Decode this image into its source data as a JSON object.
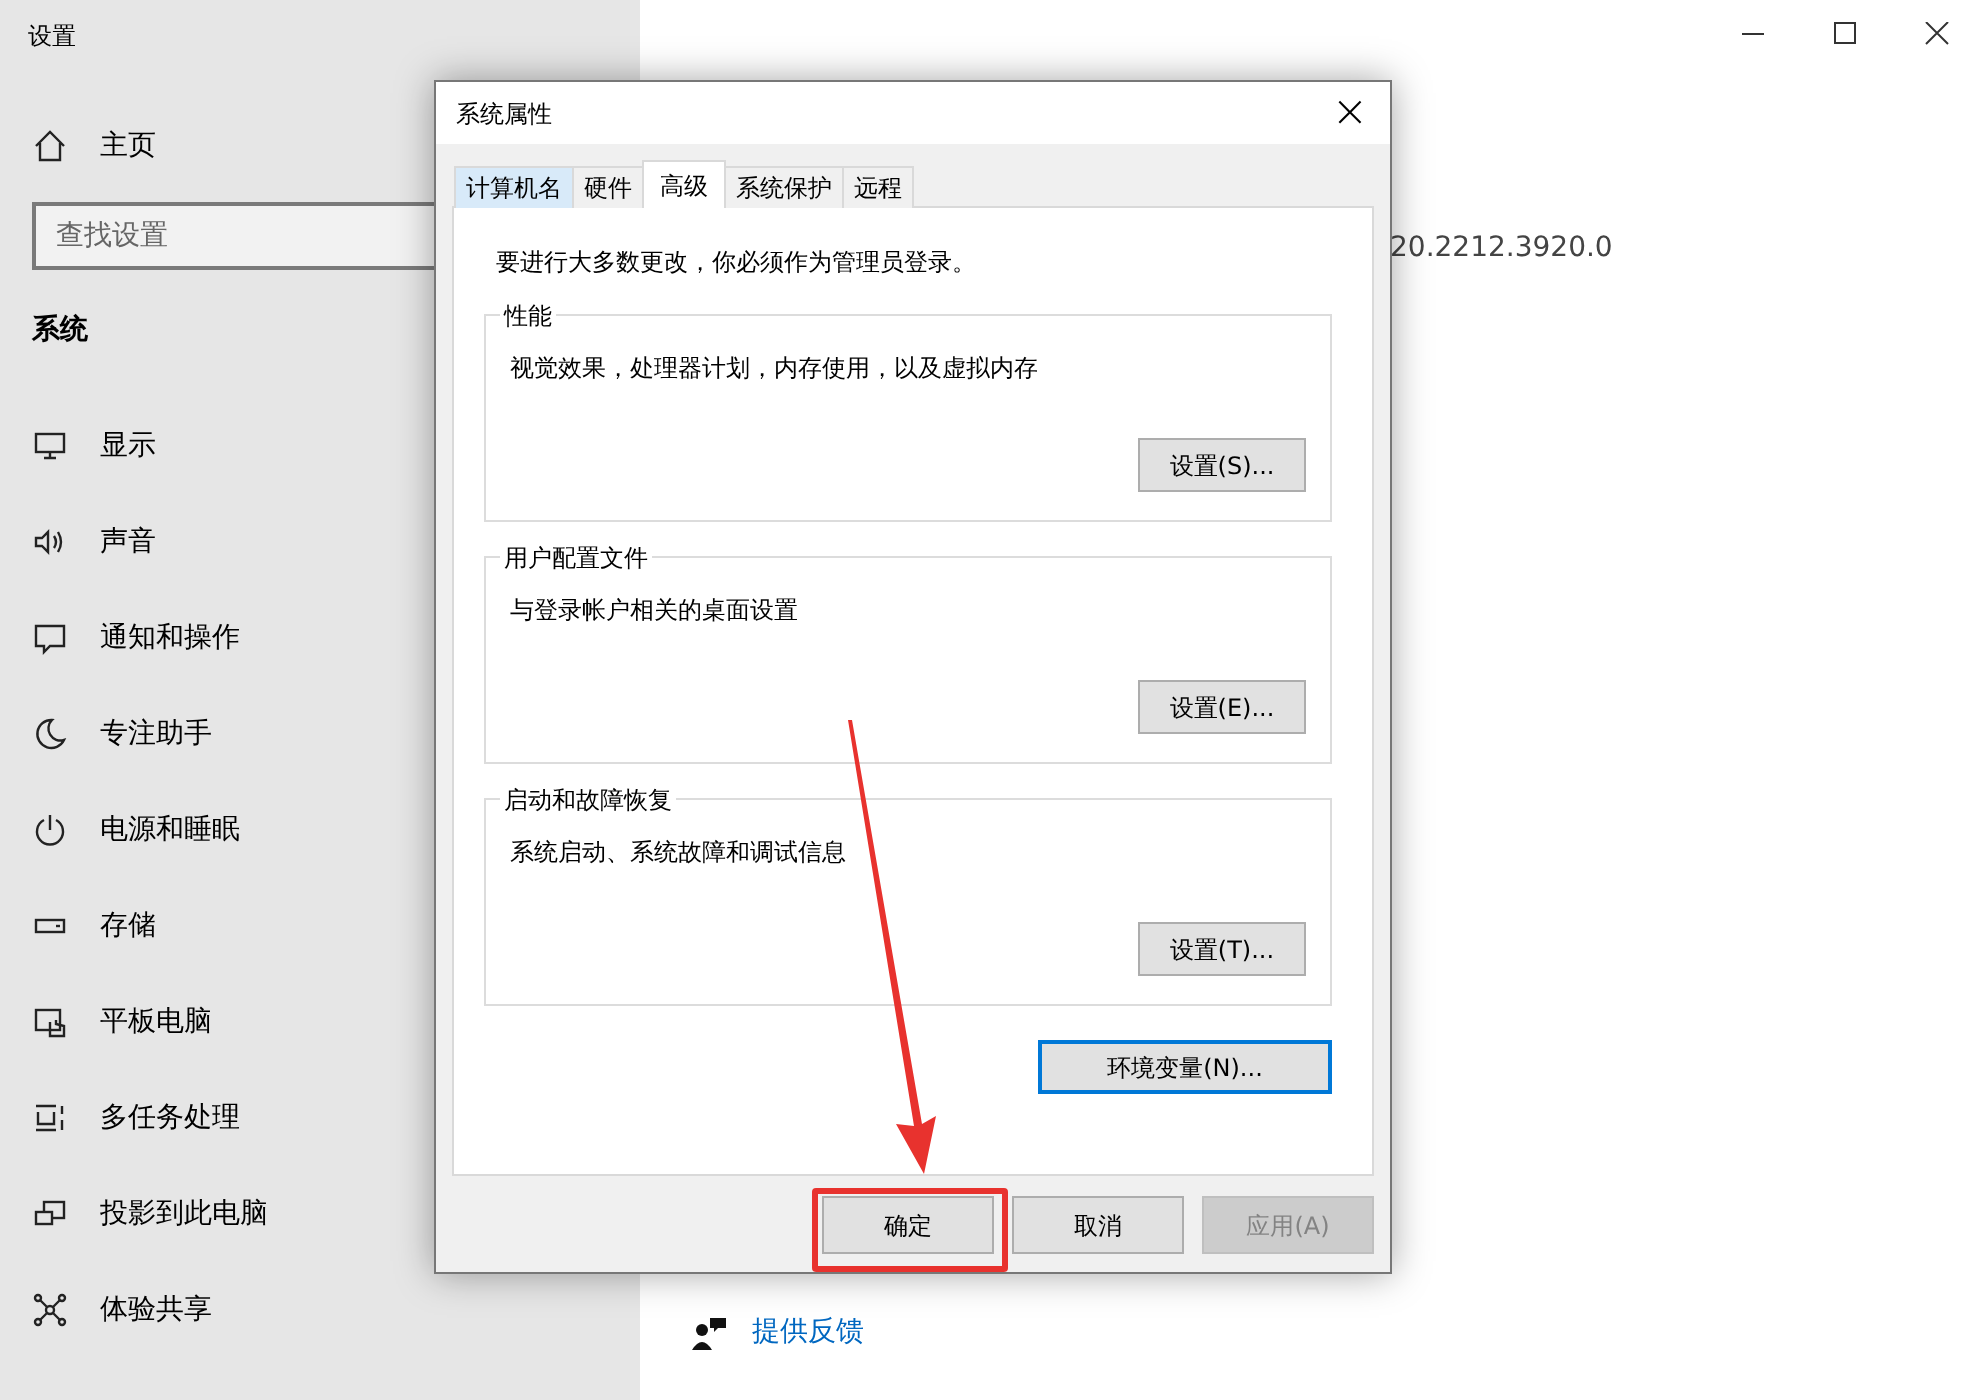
{
  "window": {
    "title": "设置"
  },
  "sidebar": {
    "home": "主页",
    "search": {
      "placeholder": "查找设置"
    },
    "section": "系统",
    "items": [
      {
        "label": "显示",
        "kind": "display"
      },
      {
        "label": "声音",
        "kind": "sound"
      },
      {
        "label": "通知和操作",
        "kind": "notify"
      },
      {
        "label": "专注助手",
        "kind": "moon"
      },
      {
        "label": "电源和睡眠",
        "kind": "power"
      },
      {
        "label": "存储",
        "kind": "storage"
      },
      {
        "label": "平板电脑",
        "kind": "tablet"
      },
      {
        "label": "多任务处理",
        "kind": "multitask"
      },
      {
        "label": "投影到此电脑",
        "kind": "project"
      },
      {
        "label": "体验共享",
        "kind": "share"
      }
    ]
  },
  "main": {
    "version": "20.2212.3920.0",
    "feedback_link": "提供反馈"
  },
  "dialog": {
    "title": "系统属性",
    "close": "×",
    "tabs": [
      {
        "label": "计算机名",
        "selected": false,
        "hovered": true
      },
      {
        "label": "硬件",
        "selected": false,
        "hovered": false
      },
      {
        "label": "高级",
        "selected": true,
        "hovered": false
      },
      {
        "label": "系统保护",
        "selected": false,
        "hovered": false
      },
      {
        "label": "远程",
        "selected": false,
        "hovered": false
      }
    ],
    "notice": "要进行大多数更改，你必须作为管理员登录。",
    "groups": [
      {
        "title": "性能",
        "description": "视觉效果，处理器计划，内存使用，以及虚拟内存",
        "button": "设置(S)..."
      },
      {
        "title": "用户配置文件",
        "description": "与登录帐户相关的桌面设置",
        "button": "设置(E)..."
      },
      {
        "title": "启动和故障恢复",
        "description": "系统启动、系统故障和调试信息",
        "button": "设置(T)..."
      }
    ],
    "env_button": {
      "label": "环境变量(N)...",
      "focused": true
    },
    "buttons": [
      {
        "label": "确定",
        "disabled": false,
        "highlighted": true
      },
      {
        "label": "取消",
        "disabled": false,
        "highlighted": false
      },
      {
        "label": "应用(A)",
        "disabled": true,
        "highlighted": false
      }
    ]
  }
}
